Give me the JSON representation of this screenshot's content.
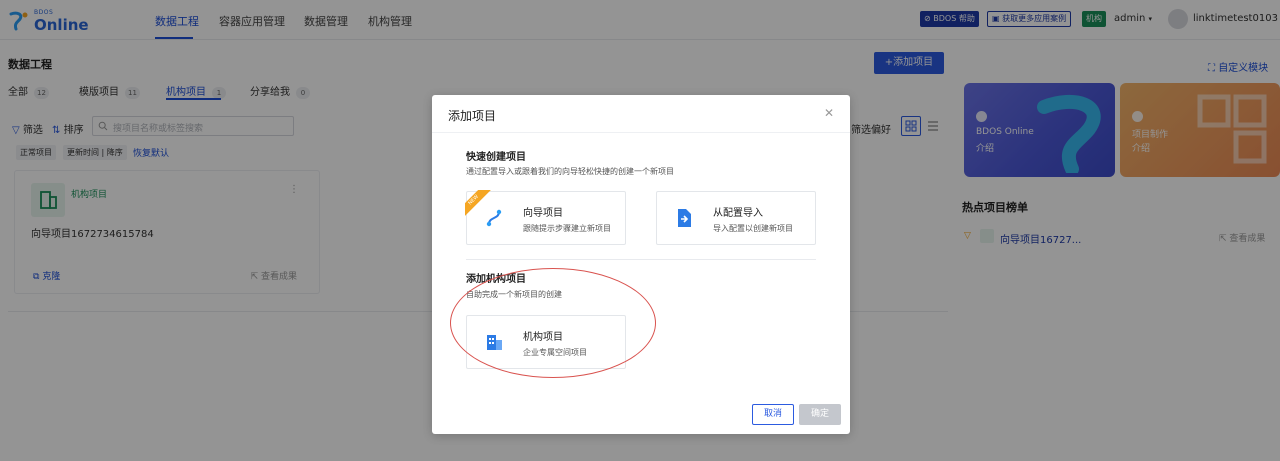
{
  "brand": {
    "small": "BDOS",
    "big": "Online"
  },
  "nav": {
    "tabs": [
      "数据工程",
      "容器应用管理",
      "数据管理",
      "机构管理"
    ],
    "help": "BDOS 帮助",
    "more_cases": "获取更多应用案例",
    "org_badge": "机构",
    "admin": "admin",
    "username": "linktimetest0103"
  },
  "page": {
    "title": "数据工程",
    "add_button": "+添加项目",
    "custom_module": "自定义模块",
    "tabs": [
      {
        "label": "全部",
        "count": "12"
      },
      {
        "label": "模版项目",
        "count": "11"
      },
      {
        "label": "机构项目",
        "count": "1"
      },
      {
        "label": "分享给我",
        "count": "0"
      }
    ],
    "filter": "筛选",
    "sort": "排序",
    "search_placeholder": "搜项目名称或标签搜索",
    "chips": [
      "正常项目",
      "更新时间 | 降序"
    ],
    "reset": "恢复默认",
    "filter_pref": "筛选偏好",
    "card": {
      "type": "机构项目",
      "name": "向导项目1672734615784",
      "clone": "克隆",
      "view": "查看成果"
    }
  },
  "right": {
    "banners": [
      {
        "l1": "BDOS Online",
        "l2": "介绍"
      },
      {
        "l1": "项目制作",
        "l2": "介绍"
      }
    ],
    "hot_title": "热点项目榜单",
    "hot_item": "向导项目16727...",
    "hot_view": "查看成果"
  },
  "modal": {
    "title": "添加项目",
    "quick": {
      "title": "快速创建项目",
      "desc": "通过配置导入或跟着我们的向导轻松快捷的创建一个新项目",
      "options": [
        {
          "title": "向导项目",
          "desc": "跟随提示步骤建立新项目",
          "tag": "NEW"
        },
        {
          "title": "从配置导入",
          "desc": "导入配置以创建新项目"
        }
      ]
    },
    "org": {
      "title": "添加机构项目",
      "desc": "自助完成一个新项目的创建",
      "option": {
        "title": "机构项目",
        "desc": "企业专属空间项目"
      }
    },
    "cancel": "取消",
    "ok": "确定"
  },
  "colors": {
    "accent": "#2c5be0",
    "org_green": "#1a8f5a",
    "annotation": "#d9534f"
  }
}
